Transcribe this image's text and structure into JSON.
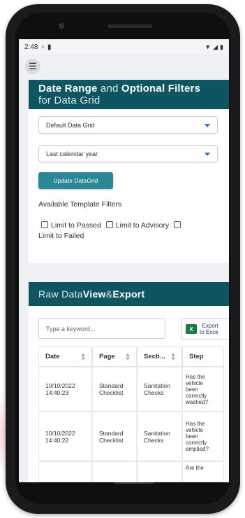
{
  "status": {
    "time": "2:48"
  },
  "filters": {
    "title_bold1": "Date Range",
    "title_mid": " and ",
    "title_bold2": "Optional Filters",
    "title_light": "for Data Grid",
    "grid_select": "Default Data Grid",
    "range_select": "Last calendar year",
    "update_button": "Update DataGrid",
    "template_label": "Available Template Filters",
    "checkboxes": [
      "Limit to Passed",
      "Limit to Advisory",
      "Limit to Failed"
    ]
  },
  "data_section": {
    "title_light": "Raw Data ",
    "title_bold1": "View",
    "title_mid": " & ",
    "title_bold2": "Export",
    "search_placeholder": "Type a keyword...",
    "export_line1": "Export",
    "export_line2": "to Exce",
    "columns": [
      "Date",
      "Page",
      "Secti...",
      "Step"
    ],
    "rows": [
      {
        "date": "10/10/2022\n14:40:23",
        "page": "Standard\nChecklist",
        "section": "Sanitation\nChecks",
        "step": "Has the\nvehicle\nbeen\ncorrectly\nwashed?"
      },
      {
        "date": "10/10/2022\n14:40:22",
        "page": "Standard\nChecklist",
        "section": "Sanitation\nChecks",
        "step": "Has the\nvehicle\nbeen\ncorrectly\nemptied?"
      },
      {
        "date": "",
        "page": "",
        "section": "",
        "step": "Are the"
      }
    ]
  }
}
